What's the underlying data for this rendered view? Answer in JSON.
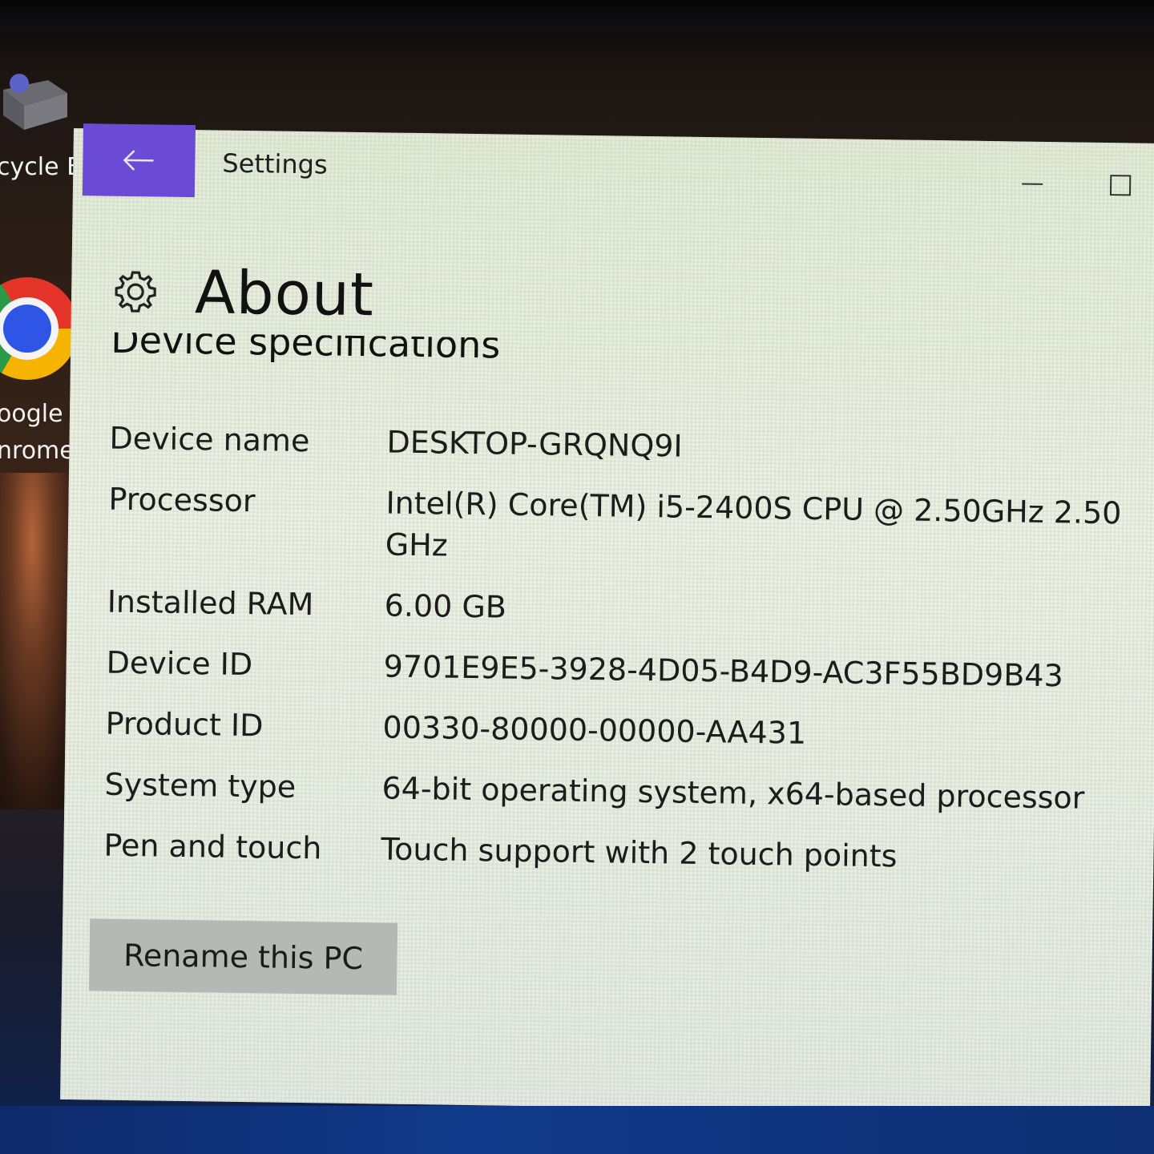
{
  "desktop": {
    "recycle_bin_label": "cycle Bi",
    "chrome_label_line1": "oogle",
    "chrome_label_line2": "nrome"
  },
  "window": {
    "title": "Settings",
    "back_icon": "arrow-left-icon",
    "accent_color": "#6b4bd6"
  },
  "page": {
    "title": "About",
    "section_title": "Device specifications"
  },
  "specs": [
    {
      "label": "Device name",
      "value": "DESKTOP-GRQNQ9I"
    },
    {
      "label": "Processor",
      "value": "Intel(R) Core(TM) i5-2400S CPU @ 2.50GHz   2.50 GHz"
    },
    {
      "label": "Installed RAM",
      "value": "6.00 GB"
    },
    {
      "label": "Device ID",
      "value": "9701E9E5-3928-4D05-B4D9-AC3F55BD9B43"
    },
    {
      "label": "Product ID",
      "value": "00330-80000-00000-AA431"
    },
    {
      "label": "System type",
      "value": "64-bit operating system, x64-based processor"
    },
    {
      "label": "Pen and touch",
      "value": "Touch support with 2 touch points"
    }
  ],
  "actions": {
    "rename_label": "Rename this PC"
  }
}
